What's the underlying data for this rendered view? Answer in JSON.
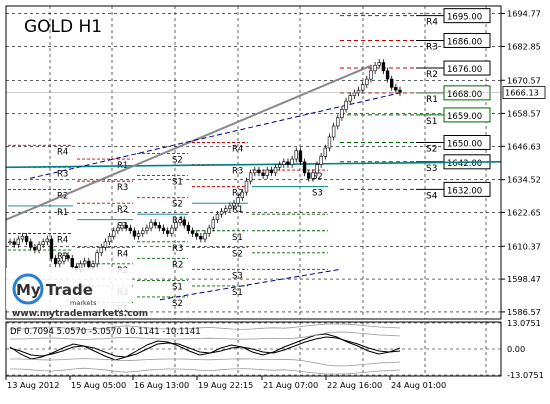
{
  "chart_data": [
    {
      "type": "candlestick",
      "title": "GOLD H1",
      "ylim": [
        1584.0,
        1697.5
      ],
      "yticks": [
        1694.77,
        1682.85,
        1670.57,
        1658.57,
        1646.63,
        1634.52,
        1622.65,
        1610.37,
        1598.47,
        1586.57
      ],
      "xticks": [
        "13 Aug 2012",
        "15 Aug 05:00",
        "16 Aug 13:00",
        "19 Aug 22:15",
        "21 Aug 07:00",
        "22 Aug 16:00",
        "24 Aug 01:00"
      ],
      "current_price": "1666.13",
      "series": [
        {
          "name": "price",
          "values": [
            1612,
            1611,
            1613,
            1614,
            1612,
            1610,
            1609,
            1611,
            1612,
            1613,
            1606,
            1604,
            1605,
            1607,
            1606,
            1603,
            1602,
            1604,
            1605,
            1603,
            1604,
            1608,
            1610,
            1612,
            1614,
            1616,
            1617,
            1618,
            1617,
            1616,
            1614,
            1615,
            1616,
            1617,
            1619,
            1618,
            1617,
            1616,
            1615,
            1617,
            1619,
            1620,
            1618,
            1616,
            1615,
            1614,
            1613,
            1615,
            1617,
            1620,
            1622,
            1623,
            1624,
            1625,
            1626,
            1628,
            1630,
            1634,
            1637,
            1638,
            1637,
            1636,
            1638,
            1637,
            1639,
            1640,
            1641,
            1640,
            1642,
            1645,
            1641,
            1637,
            1635,
            1637,
            1640,
            1643,
            1646,
            1650,
            1654,
            1657,
            1660,
            1663,
            1665,
            1666,
            1667,
            1669,
            1671,
            1674,
            1676,
            1677,
            1674,
            1671,
            1668,
            1667,
            1666
          ]
        }
      ],
      "levels": [
        {
          "label": "R4",
          "value": 1694.0
        },
        {
          "label": "R3",
          "value": 1685.0
        },
        {
          "label": "R2",
          "value": 1675.0
        },
        {
          "label": "R1",
          "value": 1666.0
        },
        {
          "label": "S1",
          "value": 1658.0
        },
        {
          "label": "S2",
          "value": 1648.0
        },
        {
          "label": "S3",
          "value": 1641.0
        },
        {
          "label": "S4",
          "value": 1631.0
        }
      ],
      "level_boxes": [
        "1695.00",
        "1686.00",
        "1676.00",
        "1668.00",
        "1659.00",
        "1650.00",
        "1642.00",
        "1632.00"
      ],
      "old_pivot_labels": [
        "R4",
        "R3",
        "R2",
        "R1",
        "R4",
        "R2",
        "R1",
        "R3",
        "R2",
        "S1",
        "R4",
        "R2",
        "R3",
        "R1",
        "S2",
        "S1",
        "S2",
        "R4",
        "R3",
        "R2",
        "S1",
        "S2",
        "R4",
        "R3",
        "R2",
        "R1",
        "S1",
        "S2",
        "S3",
        "S1",
        "S2",
        "S3"
      ],
      "colors": {
        "resistance": "#cc0000",
        "support": "#006400",
        "pivot": "#008080",
        "trend_blue": "#00008b",
        "trend_gray": "#888888",
        "price_box_green": "#006400"
      }
    },
    {
      "type": "line",
      "title": "DF 0.7094 5.0570 -5.0570 10.1141 -10.1141",
      "ylim": [
        -13.5,
        13.5
      ],
      "yticks": [
        "13.0751",
        "0.00",
        "-13.0751"
      ],
      "series": [
        {
          "name": "line1",
          "values": [
            1.0,
            -2.5,
            -5.0,
            -4.0,
            -2.0,
            0.5,
            2.5,
            1.5,
            -1.0,
            -3.5,
            -5.5,
            -4.0,
            -1.0,
            2.0,
            4.0,
            3.5,
            1.5,
            -1.0,
            -3.0,
            -2.0,
            0.5,
            2.0,
            1.0,
            -1.5,
            -3.0,
            -1.5,
            1.0,
            3.0,
            5.0,
            7.0,
            7.5,
            6.0,
            3.5,
            1.5,
            -1.0,
            -2.5,
            -1.5,
            0.5
          ]
        },
        {
          "name": "line2",
          "values": [
            0.5,
            -1.0,
            -3.0,
            -3.5,
            -2.5,
            -1.0,
            1.0,
            1.5,
            0.5,
            -1.5,
            -3.5,
            -4.0,
            -2.5,
            0.0,
            2.5,
            3.0,
            2.5,
            0.5,
            -1.5,
            -2.0,
            -1.0,
            0.5,
            1.0,
            0.0,
            -1.5,
            -2.0,
            -0.5,
            1.5,
            3.5,
            5.0,
            6.0,
            5.5,
            4.0,
            2.5,
            0.5,
            -1.0,
            -1.5,
            -1.0
          ]
        },
        {
          "name": "band_upper",
          "values": [
            5.0,
            5.0,
            5.2,
            5.4,
            5.5,
            5.3,
            5.0,
            4.8,
            5.0,
            5.2,
            5.6,
            5.8,
            5.6,
            5.3,
            5.1,
            5.0,
            5.0,
            5.1,
            5.3,
            5.4,
            5.2,
            5.0,
            4.9,
            5.0,
            5.2,
            5.3,
            5.2,
            5.4,
            6.0,
            7.0,
            8.0,
            8.5,
            8.4,
            8.0,
            7.5,
            7.0,
            6.8,
            6.5
          ]
        },
        {
          "name": "band_lower",
          "values": [
            -5.0,
            -5.0,
            -5.2,
            -5.4,
            -5.5,
            -5.3,
            -5.0,
            -4.8,
            -5.0,
            -5.2,
            -5.6,
            -5.8,
            -5.6,
            -5.3,
            -5.1,
            -5.0,
            -5.0,
            -5.1,
            -5.3,
            -5.4,
            -5.2,
            -5.0,
            -4.9,
            -5.0,
            -5.2,
            -5.3,
            -5.2,
            -5.4,
            -6.0,
            -7.0,
            -8.0,
            -8.5,
            -8.4,
            -8.0,
            -7.5,
            -7.0,
            -6.8,
            -6.5
          ]
        },
        {
          "name": "band_upper_outer",
          "values": [
            10.0,
            10.0,
            10.4,
            10.8,
            11.0,
            10.6,
            10.0,
            9.6,
            10.0,
            10.4,
            11.2,
            11.6,
            11.2,
            10.6,
            10.2,
            10.0,
            10.0,
            10.2,
            10.6,
            10.8,
            10.4,
            10.0,
            9.8,
            10.0,
            10.4,
            10.6,
            10.4,
            10.8,
            11.5,
            12.0,
            12.5,
            12.5,
            12.4,
            12.0,
            11.5,
            11.0,
            10.8,
            10.5
          ]
        },
        {
          "name": "band_lower_outer",
          "values": [
            -10.0,
            -10.0,
            -10.4,
            -10.8,
            -11.0,
            -10.6,
            -10.0,
            -9.6,
            -10.0,
            -10.4,
            -11.2,
            -11.6,
            -11.2,
            -10.6,
            -10.2,
            -10.0,
            -10.0,
            -10.2,
            -10.6,
            -10.8,
            -10.4,
            -10.0,
            -9.8,
            -10.0,
            -10.4,
            -10.6,
            -10.4,
            -10.8,
            -11.5,
            -12.0,
            -12.5,
            -12.5,
            -12.4,
            -12.0,
            -11.5,
            -11.0,
            -10.8,
            -10.5
          ]
        }
      ]
    }
  ],
  "watermark": {
    "brand": "My Trade",
    "brand_sub": "markets",
    "url": "www.mytrademarkets.com"
  }
}
